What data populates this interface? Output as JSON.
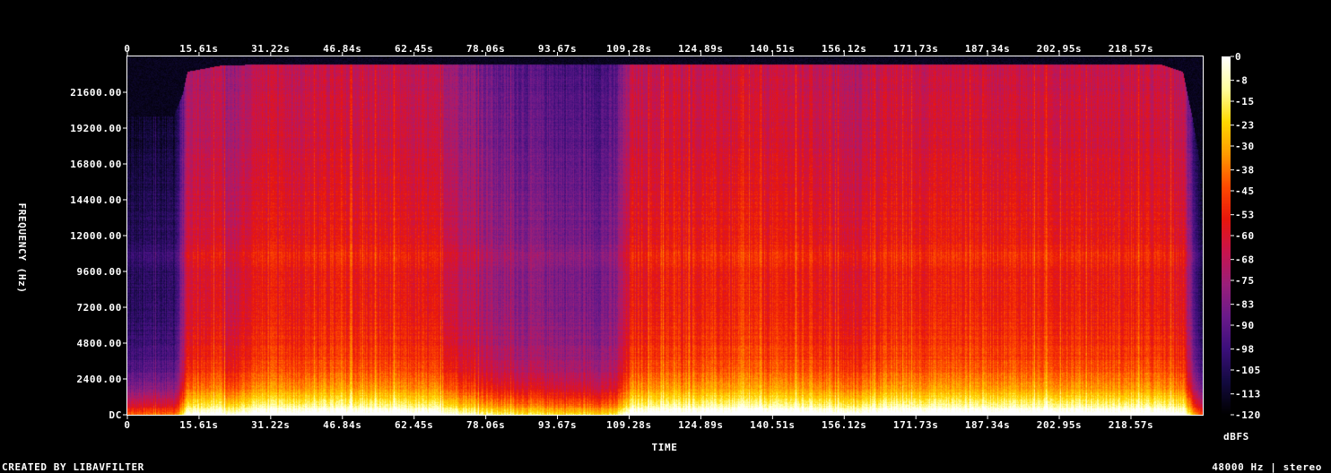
{
  "chart_data": {
    "type": "heatmap",
    "title": "",
    "xlabel": "TIME",
    "ylabel": "FREQUENCY (Hz)",
    "x_ticks": [
      "0",
      "15.61s",
      "31.22s",
      "46.84s",
      "62.45s",
      "78.06s",
      "93.67s",
      "109.28s",
      "124.89s",
      "140.51s",
      "156.12s",
      "171.73s",
      "187.34s",
      "202.95s",
      "218.57s"
    ],
    "x_tick_values": [
      0,
      15.61,
      31.22,
      46.84,
      62.45,
      78.06,
      93.67,
      109.28,
      124.89,
      140.51,
      156.12,
      171.73,
      187.34,
      202.95,
      218.57
    ],
    "xlim": [
      0,
      234.2
    ],
    "y_ticks": [
      "DC",
      "2400.00",
      "4800.00",
      "7200.00",
      "9600.00",
      "12000.00",
      "14400.00",
      "16800.00",
      "19200.00",
      "21600.00"
    ],
    "y_tick_values": [
      0,
      2400,
      4800,
      7200,
      9600,
      12000,
      14400,
      16800,
      19200,
      21600
    ],
    "ylim": [
      0,
      24000
    ],
    "colorbar": {
      "label": "dBFS",
      "ticks": [
        "0",
        "-8",
        "-15",
        "-23",
        "-30",
        "-38",
        "-45",
        "-53",
        "-60",
        "-68",
        "-75",
        "-83",
        "-90",
        "-98",
        "-105",
        "-113",
        "-120"
      ],
      "tick_values": [
        0,
        -8,
        -15,
        -23,
        -30,
        -38,
        -45,
        -53,
        -60,
        -68,
        -75,
        -83,
        -90,
        -98,
        -105,
        -113,
        -120
      ],
      "range": [
        -120,
        0
      ]
    },
    "energy_profile": {
      "description_of_values": "approximate level (dBFS) of upper spectrum and width of bright low band over time",
      "time": [
        0,
        5,
        10,
        12,
        13,
        20,
        22,
        28,
        40,
        55,
        65,
        70,
        75,
        80,
        85,
        90,
        95,
        100,
        106,
        110,
        120,
        135,
        150,
        158,
        162,
        170,
        185,
        200,
        215,
        225,
        230,
        232,
        234.2
      ],
      "upper_level_db": [
        -108,
        -106,
        -104,
        -85,
        -64,
        -60,
        -70,
        -58,
        -57,
        -58,
        -60,
        -65,
        -72,
        -80,
        -82,
        -84,
        -86,
        -87,
        -86,
        -58,
        -57,
        -56,
        -57,
        -64,
        -58,
        -56,
        -55,
        -56,
        -57,
        -58,
        -60,
        -90,
        -110
      ],
      "high_freq_cutoff_hz": [
        20000,
        20000,
        20000,
        21500,
        23000,
        23400,
        23400,
        23500,
        23500,
        23500,
        23500,
        23500,
        23500,
        23500,
        23500,
        23500,
        23500,
        23500,
        23500,
        23500,
        23500,
        23500,
        23500,
        23500,
        23500,
        23500,
        23500,
        23500,
        23500,
        23500,
        23000,
        20000,
        16000
      ]
    },
    "colormap": [
      "#000000",
      "#130a40",
      "#3b0f7a",
      "#6a1a8a",
      "#9a1f7a",
      "#c8144d",
      "#e8160c",
      "#ff4a00",
      "#ff9a00",
      "#ffd800",
      "#ffff9c",
      "#ffffff"
    ]
  },
  "footer": {
    "left_text": "CREATED BY LIBAVFILTER",
    "right_text": "48000 Hz | stereo"
  },
  "colors": {
    "background": "#000000",
    "text": "#ffffff",
    "frame": "#ffffff"
  }
}
